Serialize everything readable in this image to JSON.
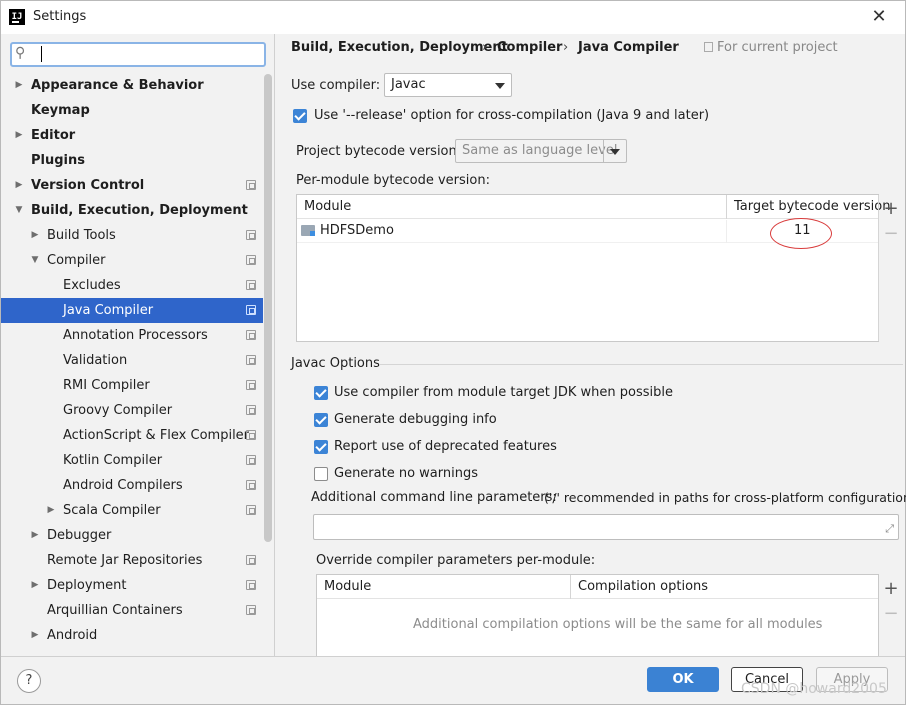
{
  "window": {
    "title": "Settings",
    "close_glyph": "✕"
  },
  "search": {
    "value": ""
  },
  "sidebar": {
    "items": [
      {
        "label": "Appearance & Behavior",
        "expandable": true,
        "expanded": false,
        "bold": true,
        "level": 0,
        "project": false
      },
      {
        "label": "Keymap",
        "expandable": false,
        "bold": true,
        "level": 0,
        "project": false
      },
      {
        "label": "Editor",
        "expandable": true,
        "expanded": false,
        "bold": true,
        "level": 0,
        "project": false
      },
      {
        "label": "Plugins",
        "expandable": false,
        "bold": true,
        "level": 0,
        "project": false
      },
      {
        "label": "Version Control",
        "expandable": true,
        "expanded": false,
        "bold": true,
        "level": 0,
        "project": true
      },
      {
        "label": "Build, Execution, Deployment",
        "expandable": true,
        "expanded": true,
        "bold": true,
        "level": 0,
        "project": false
      },
      {
        "label": "Build Tools",
        "expandable": true,
        "expanded": false,
        "bold": false,
        "level": 1,
        "project": true
      },
      {
        "label": "Compiler",
        "expandable": true,
        "expanded": true,
        "bold": false,
        "level": 1,
        "project": true
      },
      {
        "label": "Excludes",
        "expandable": false,
        "bold": false,
        "level": 2,
        "project": true
      },
      {
        "label": "Java Compiler",
        "expandable": false,
        "bold": false,
        "level": 2,
        "project": true,
        "selected": true
      },
      {
        "label": "Annotation Processors",
        "expandable": false,
        "bold": false,
        "level": 2,
        "project": true
      },
      {
        "label": "Validation",
        "expandable": false,
        "bold": false,
        "level": 2,
        "project": true
      },
      {
        "label": "RMI Compiler",
        "expandable": false,
        "bold": false,
        "level": 2,
        "project": true
      },
      {
        "label": "Groovy Compiler",
        "expandable": false,
        "bold": false,
        "level": 2,
        "project": true
      },
      {
        "label": "ActionScript & Flex Compiler",
        "expandable": false,
        "bold": false,
        "level": 2,
        "project": true
      },
      {
        "label": "Kotlin Compiler",
        "expandable": false,
        "bold": false,
        "level": 2,
        "project": true
      },
      {
        "label": "Android Compilers",
        "expandable": false,
        "bold": false,
        "level": 2,
        "project": true
      },
      {
        "label": "Scala Compiler",
        "expandable": true,
        "expanded": false,
        "bold": false,
        "level": 2,
        "project": true
      },
      {
        "label": "Debugger",
        "expandable": true,
        "expanded": false,
        "bold": false,
        "level": 1,
        "project": false
      },
      {
        "label": "Remote Jar Repositories",
        "expandable": false,
        "bold": false,
        "level": 1,
        "project": true
      },
      {
        "label": "Deployment",
        "expandable": true,
        "expanded": false,
        "bold": false,
        "level": 1,
        "project": true
      },
      {
        "label": "Arquillian Containers",
        "expandable": false,
        "bold": false,
        "level": 1,
        "project": true
      },
      {
        "label": "Android",
        "expandable": true,
        "expanded": false,
        "bold": false,
        "level": 1,
        "project": false
      }
    ]
  },
  "breadcrumb": {
    "parts": [
      "Build, Execution, Deployment",
      "Compiler",
      "Java Compiler"
    ],
    "separator": "›",
    "scope": "For current project"
  },
  "compiler": {
    "use_compiler_label": "Use compiler:",
    "use_compiler_value": "Javac",
    "release_option_label": "Use '--release' option for cross-compilation (Java 9 and later)",
    "release_option_checked": true,
    "project_bytecode_label": "Project bytecode version:",
    "project_bytecode_value": "Same as language level",
    "per_module_label": "Per-module bytecode version:",
    "module_table": {
      "headers": [
        "Module",
        "Target bytecode version"
      ],
      "rows": [
        {
          "module": "HDFSDemo",
          "target": "11"
        }
      ],
      "add_glyph": "+",
      "remove_glyph": "−"
    }
  },
  "javac": {
    "section_title": "Javac Options",
    "options": [
      {
        "label": "Use compiler from module target JDK when possible",
        "checked": true
      },
      {
        "label": "Generate debugging info",
        "checked": true
      },
      {
        "label": "Report use of deprecated features",
        "checked": true
      },
      {
        "label": "Generate no warnings",
        "checked": false
      }
    ],
    "cmd_params_label": "Additional command line parameters:",
    "cmd_params_hint": "('/' recommended in paths for cross-platform configurations)",
    "cmd_params_value": "",
    "override_label": "Override compiler parameters per-module:",
    "override_table": {
      "headers": [
        "Module",
        "Compilation options"
      ],
      "empty_text": "Additional compilation options will be the same for all modules",
      "add_glyph": "+",
      "remove_glyph": "−"
    }
  },
  "footer": {
    "help_label": "?",
    "ok_label": "OK",
    "cancel_label": "Cancel",
    "apply_label": "Apply"
  },
  "watermark": "CSDN @howard2005",
  "colors": {
    "accent": "#3b82d3",
    "selection": "#2f65ca",
    "annotation": "#d93c3c"
  }
}
